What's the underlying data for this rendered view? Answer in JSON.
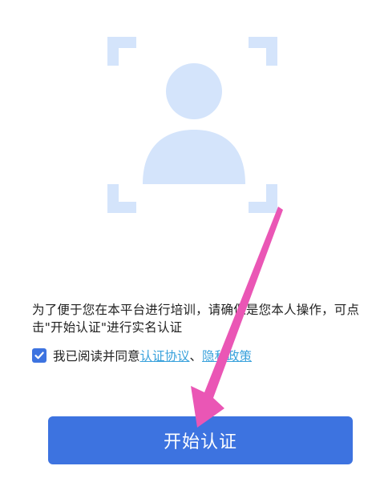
{
  "colors": {
    "illustration": "#d4e4fb",
    "primary": "#3d73e0",
    "link": "#3aa2dc",
    "annotation_arrow": "#ea56b5"
  },
  "notice": {
    "text": "为了便于您在本平台进行培训，请确保是您本人操作，可点击\"开始认证\"进行实名认证"
  },
  "agreement": {
    "checked": true,
    "prefix": "我已阅读并同意",
    "link1": "认证协议",
    "separator": "、",
    "link2": "隐私政策"
  },
  "start_button": {
    "label": "开始认证"
  },
  "icons": {
    "illustration": "face-frame-icon",
    "checkbox": "check-icon",
    "arrow": "arrow-annotation-icon"
  }
}
